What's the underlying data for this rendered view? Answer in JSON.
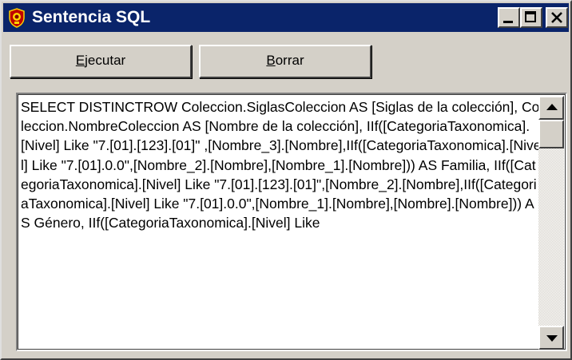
{
  "window": {
    "title": "Sentencia SQL",
    "icon": "app-emblem-icon"
  },
  "caption_buttons": {
    "minimize_icon": "minimize-icon",
    "maximize_icon": "maximize-icon",
    "close_icon": "close-icon"
  },
  "toolbar": {
    "execute": {
      "mnemonic": "E",
      "rest": "jecutar"
    },
    "clear": {
      "mnemonic": "B",
      "rest": "orrar"
    }
  },
  "editor": {
    "sql": "SELECT DISTINCTROW Coleccion.SiglasColeccion AS [Siglas de la colección], Coleccion.NombreColeccion AS [Nombre de la colección], IIf([CategoriaTaxonomica].[Nivel] Like \"7.[01].[123].[01]\" ,[Nombre_3].[Nombre],IIf([CategoriaTaxonomica].[Nivel] Like \"7.[01].0.0\",[Nombre_2].[Nombre],[Nombre_1].[Nombre])) AS Familia, IIf([CategoriaTaxonomica].[Nivel] Like \"7.[01].[123].[01]\",[Nombre_2].[Nombre],IIf([CategoriaTaxonomica].[Nivel] Like \"7.[01].0.0\",[Nombre_1].[Nombre],[Nombre].[Nombre])) AS Género, IIf([CategoriaTaxonomica].[Nivel] Like",
    "scroll_position": 0.0
  },
  "colors": {
    "titlebar": "#0a246a",
    "face": "#d4d0c8",
    "title_text": "#ffffff"
  }
}
